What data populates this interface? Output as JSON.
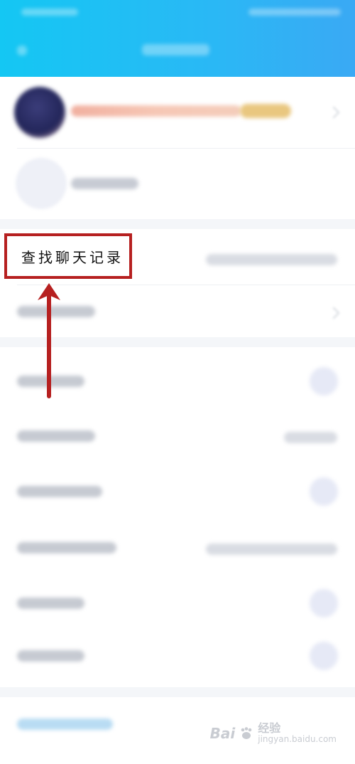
{
  "highlight": {
    "label": "查找聊天记录"
  },
  "watermark": {
    "brand": "Bai",
    "brand_cn": "经验",
    "url": "jingyan.baidu.com"
  },
  "colors": {
    "header": "#1bc2f3",
    "highlight_border": "#b62020",
    "arrow": "#b62020"
  }
}
